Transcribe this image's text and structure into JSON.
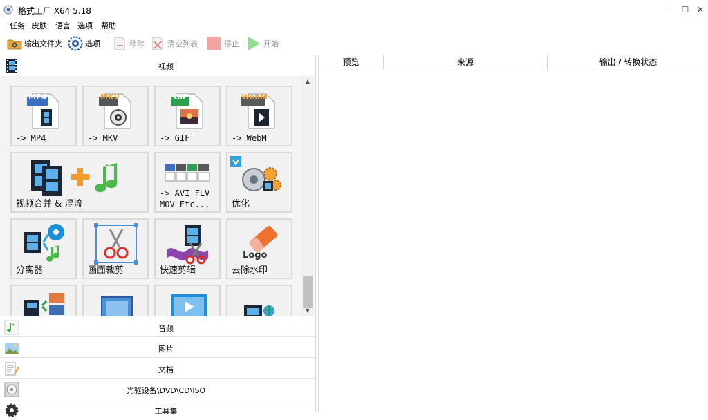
{
  "window": {
    "title": "格式工厂 X64 5.18",
    "controls": {
      "minimize": "–",
      "maximize": "☐",
      "close": "✕"
    }
  },
  "menu": [
    "任务",
    "皮肤",
    "语言",
    "选项",
    "帮助"
  ],
  "toolbar": {
    "output_folder": "输出文件夹",
    "options": "选项",
    "remove": "移除",
    "clear_list": "清空列表",
    "stop": "停止",
    "start": "开始"
  },
  "categories": {
    "video": "视频",
    "audio": "音频",
    "image": "图片",
    "document": "文档",
    "optical": "光驱设备\\DVD\\CD\\ISO",
    "tools": "工具集"
  },
  "tiles": {
    "mp4": {
      "badge": "MP4",
      "label": "-> MP4"
    },
    "mkv": {
      "badge": "MKV",
      "label": "-> MKV"
    },
    "gif": {
      "badge": "GIF",
      "label": "-> GIF"
    },
    "webm": {
      "badge": "WebM",
      "label": "-> WebM"
    },
    "merge": {
      "label": "视频合并 & 混流"
    },
    "other": {
      "label": "-> AVI FLV\nMOV Etc..."
    },
    "optimize": {
      "label": "优化"
    },
    "splitter": {
      "label": "分离器"
    },
    "crop": {
      "label": "画面裁剪"
    },
    "quick_clip": {
      "label": "快速剪辑"
    },
    "watermark": {
      "logo_text": "Logo",
      "label": "去除水印"
    }
  },
  "task_table": {
    "columns": [
      "预览",
      "来源",
      "输出 / 转换状态"
    ]
  },
  "colors": {
    "mp4_badge": "#3b6fc4",
    "mkv_badge": "#555555",
    "gif_badge": "#2e9e4f",
    "webm_badge": "#5a5a5a",
    "stop_red": "#f0a0a0",
    "start_green": "#8fd88f"
  }
}
